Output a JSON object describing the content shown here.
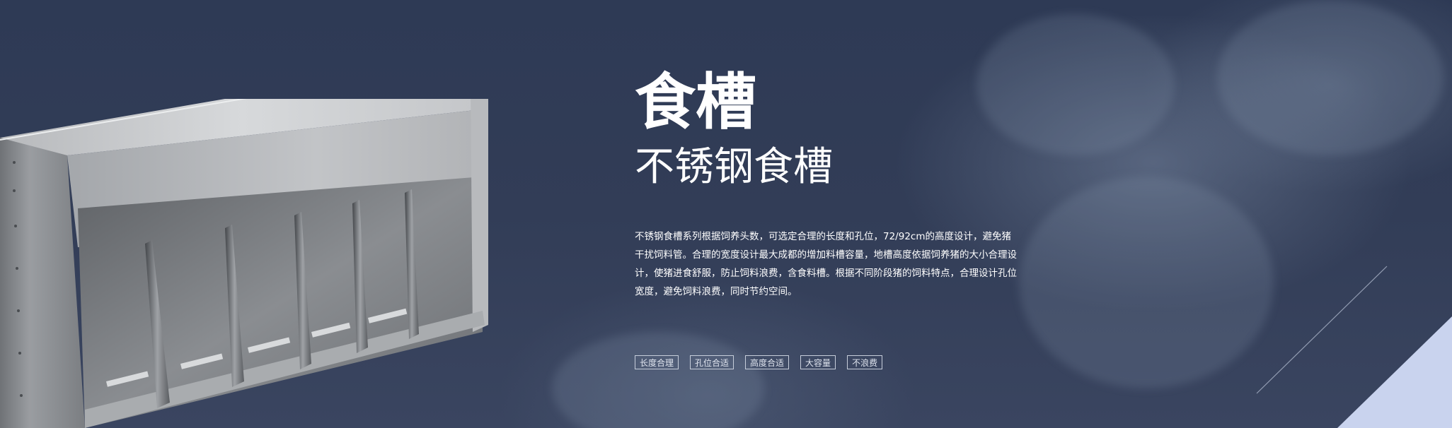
{
  "banner": {
    "title": "食槽",
    "subtitle": "不锈钢食槽",
    "description": "不锈钢食槽系列根据饲养头数，可选定合理的长度和孔位，72/92cm的高度设计，避免猪干扰饲料管。合理的宽度设计最大成都的增加料槽容量，地槽高度依据饲养猪的大小合理设计，使猪进食舒服，防止饲料浪费，含食料槽。根据不同阶段猪的饲料特点，合理设计孔位宽度，避免饲料浪费，同时节约空间。",
    "tags": [
      "长度合理",
      "孔位合适",
      "高度合适",
      "大容量",
      "不浪费"
    ]
  },
  "colors": {
    "background": "#2f3a52",
    "corner_accent": "#c9d3ee",
    "text": "#ffffff"
  },
  "icons": {
    "product_image": "stainless-steel-trough",
    "decoration": "diagonal-line"
  }
}
